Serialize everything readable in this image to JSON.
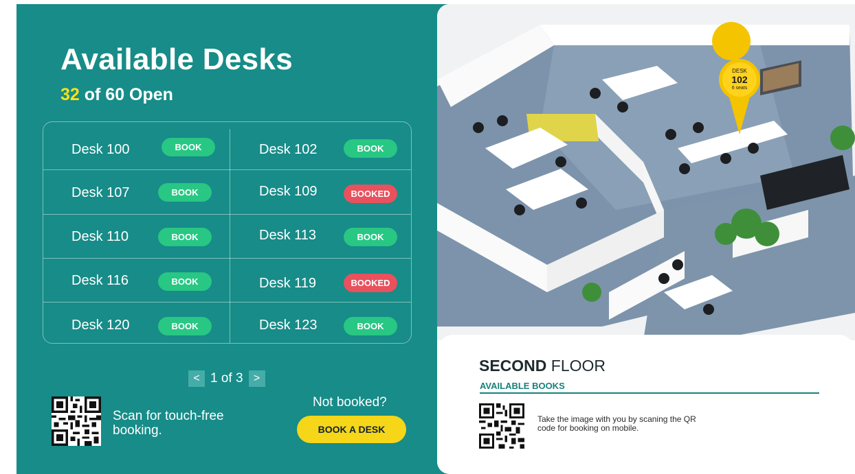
{
  "left_panel": {
    "title": "Available Desks",
    "open_count": "32",
    "open_suffix": "of 60 Open",
    "desks": [
      {
        "name": "Desk 100",
        "status": "BOOK"
      },
      {
        "name": "Desk 102",
        "status": "BOOK"
      },
      {
        "name": "Desk 107",
        "status": "BOOK"
      },
      {
        "name": "Desk 109",
        "status": "BOOKED"
      },
      {
        "name": "Desk 110",
        "status": "BOOK"
      },
      {
        "name": "Desk 113",
        "status": "BOOK"
      },
      {
        "name": "Desk 116",
        "status": "BOOK"
      },
      {
        "name": "Desk 119",
        "status": "BOOKED"
      },
      {
        "name": "Desk 120",
        "status": "BOOK"
      },
      {
        "name": "Desk 123",
        "status": "BOOK"
      }
    ],
    "pagination": {
      "prev_icon": "<",
      "label": "1 of 3",
      "next_icon": ">"
    },
    "scan_text": "Scan for touch-free booking.",
    "not_booked": "Not booked?",
    "book_desk_button": "BOOK A DESK"
  },
  "right_panel": {
    "pin": {
      "line1": "DESK",
      "line2": "102",
      "line3": "6 seats"
    },
    "floor_bold": "SECOND",
    "floor_rest": "FLOOR",
    "available_books": "AVAILABLE BOOKS",
    "take_text": "Take the image with you by scaning the QR code for booking on mobile."
  },
  "colors": {
    "panel": "#178c88",
    "accent_yellow": "#f7e21b",
    "book_green": "#28c784",
    "booked_red": "#e8515d",
    "button_yellow": "#f5d619"
  },
  "icons": [
    "qr-code-icon",
    "chevron-left-icon",
    "chevron-right-icon",
    "location-pin-icon"
  ]
}
